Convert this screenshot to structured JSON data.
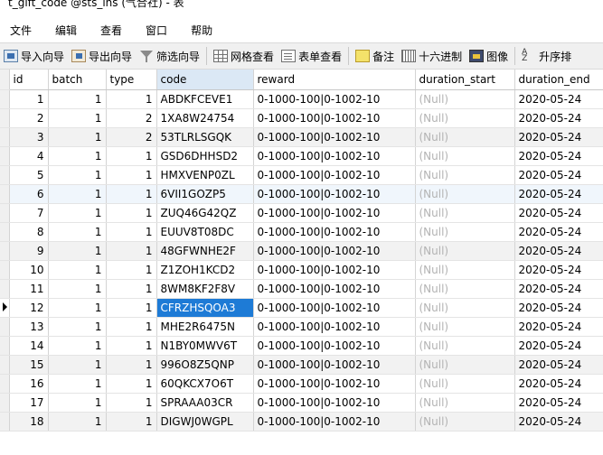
{
  "window": {
    "title": "t_gift_code @sts_ins (气合社) - 表"
  },
  "menu": [
    "文件",
    "编辑",
    "查看",
    "窗口",
    "帮助"
  ],
  "toolbar": [
    {
      "label": "导入向导",
      "icon": "import-wizard-icon"
    },
    {
      "label": "导出向导",
      "icon": "export-wizard-icon"
    },
    {
      "label": "筛选向导",
      "icon": "filter-icon"
    },
    {
      "label": "网格查看",
      "icon": "grid-view-icon"
    },
    {
      "label": "表单查看",
      "icon": "form-view-icon"
    },
    {
      "label": "备注",
      "icon": "note-icon"
    },
    {
      "label": "十六进制",
      "icon": "hex-icon"
    },
    {
      "label": "图像",
      "icon": "image-icon"
    },
    {
      "label": "升序排",
      "icon": "sort-ascending-icon"
    }
  ],
  "columns": [
    "id",
    "batch",
    "type",
    "code",
    "reward",
    "duration_start",
    "duration_end"
  ],
  "rows": [
    {
      "id": "1",
      "batch": "1",
      "type": "1",
      "code": "ABDKFCEVE1",
      "reward": "0-1000-100|0-1002-10",
      "start": "(Null)",
      "end": "2020-05-24"
    },
    {
      "id": "2",
      "batch": "1",
      "type": "2",
      "code": "1XA8W24754",
      "reward": "0-1000-100|0-1002-10",
      "start": "(Null)",
      "end": "2020-05-24"
    },
    {
      "id": "3",
      "batch": "1",
      "type": "2",
      "code": "53TLRLSGQK",
      "reward": "0-1000-100|0-1002-10",
      "start": "(Null)",
      "end": "2020-05-24"
    },
    {
      "id": "4",
      "batch": "1",
      "type": "1",
      "code": "GSD6DHHSD2",
      "reward": "0-1000-100|0-1002-10",
      "start": "(Null)",
      "end": "2020-05-24"
    },
    {
      "id": "5",
      "batch": "1",
      "type": "1",
      "code": "HMXVENP0ZL",
      "reward": "0-1000-100|0-1002-10",
      "start": "(Null)",
      "end": "2020-05-24"
    },
    {
      "id": "6",
      "batch": "1",
      "type": "1",
      "code": "6VII1GOZP5",
      "reward": "0-1000-100|0-1002-10",
      "start": "(Null)",
      "end": "2020-05-24"
    },
    {
      "id": "7",
      "batch": "1",
      "type": "1",
      "code": "ZUQ46G42QZ",
      "reward": "0-1000-100|0-1002-10",
      "start": "(Null)",
      "end": "2020-05-24"
    },
    {
      "id": "8",
      "batch": "1",
      "type": "1",
      "code": "EUUV8T08DC",
      "reward": "0-1000-100|0-1002-10",
      "start": "(Null)",
      "end": "2020-05-24"
    },
    {
      "id": "9",
      "batch": "1",
      "type": "1",
      "code": "48GFWNHE2F",
      "reward": "0-1000-100|0-1002-10",
      "start": "(Null)",
      "end": "2020-05-24"
    },
    {
      "id": "10",
      "batch": "1",
      "type": "1",
      "code": "Z1ZOH1KCD2",
      "reward": "0-1000-100|0-1002-10",
      "start": "(Null)",
      "end": "2020-05-24"
    },
    {
      "id": "11",
      "batch": "1",
      "type": "1",
      "code": "8WM8KF2F8V",
      "reward": "0-1000-100|0-1002-10",
      "start": "(Null)",
      "end": "2020-05-24"
    },
    {
      "id": "12",
      "batch": "1",
      "type": "1",
      "code": "CFRZHSQOA3",
      "reward": "0-1000-100|0-1002-10",
      "start": "(Null)",
      "end": "2020-05-24"
    },
    {
      "id": "13",
      "batch": "1",
      "type": "1",
      "code": "MHE2R6475N",
      "reward": "0-1000-100|0-1002-10",
      "start": "(Null)",
      "end": "2020-05-24"
    },
    {
      "id": "14",
      "batch": "1",
      "type": "1",
      "code": "N1BY0MWV6T",
      "reward": "0-1000-100|0-1002-10",
      "start": "(Null)",
      "end": "2020-05-24"
    },
    {
      "id": "15",
      "batch": "1",
      "type": "1",
      "code": "996O8Z5QNP",
      "reward": "0-1000-100|0-1002-10",
      "start": "(Null)",
      "end": "2020-05-24"
    },
    {
      "id": "16",
      "batch": "1",
      "type": "1",
      "code": "60QKCX7O6T",
      "reward": "0-1000-100|0-1002-10",
      "start": "(Null)",
      "end": "2020-05-24"
    },
    {
      "id": "17",
      "batch": "1",
      "type": "1",
      "code": "SPRAAA03CR",
      "reward": "0-1000-100|0-1002-10",
      "start": "(Null)",
      "end": "2020-05-24"
    },
    {
      "id": "18",
      "batch": "1",
      "type": "1",
      "code": "DIGWJ0WGPL",
      "reward": "0-1000-100|0-1002-10",
      "start": "(Null)",
      "end": "2020-05-24"
    }
  ],
  "selection": {
    "row": "12",
    "column": "code"
  }
}
